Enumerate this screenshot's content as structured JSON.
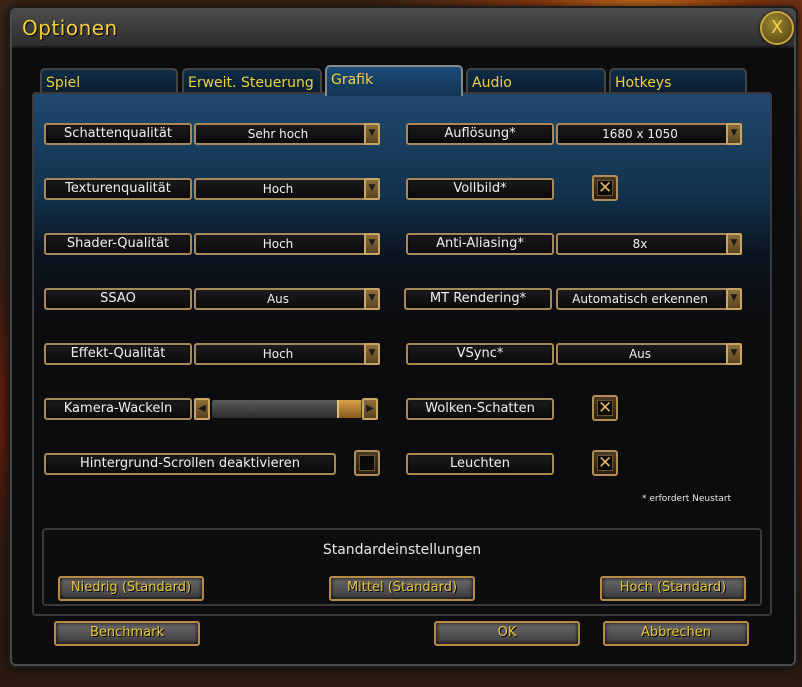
{
  "window": {
    "title": "Optionen",
    "close_glyph": "X"
  },
  "tabs": [
    {
      "label": "Spiel",
      "active": false
    },
    {
      "label": "Erweit. Steuerung",
      "active": false
    },
    {
      "label": "Grafik",
      "active": true
    },
    {
      "label": "Audio",
      "active": false
    },
    {
      "label": "Hotkeys",
      "active": false
    }
  ],
  "left_settings": [
    {
      "label": "Schattenqualität",
      "type": "dropdown",
      "value": "Sehr hoch"
    },
    {
      "label": "Texturenqualität",
      "type": "dropdown",
      "value": "Hoch"
    },
    {
      "label": "Shader-Qualität",
      "type": "dropdown",
      "value": "Hoch"
    },
    {
      "label": "SSAO",
      "type": "dropdown",
      "value": "Aus"
    },
    {
      "label": "Effekt-Qualität",
      "type": "dropdown",
      "value": "Hoch"
    },
    {
      "label": "Kamera-Wackeln",
      "type": "slider",
      "value_fraction": 0.92
    },
    {
      "label": "Hintergrund-Scrollen deaktivieren",
      "type": "checkbox",
      "checked": false
    }
  ],
  "right_settings": [
    {
      "label": "Auflösung*",
      "type": "dropdown",
      "value": "1680 x 1050"
    },
    {
      "label": "Vollbild*",
      "type": "checkbox",
      "checked": true
    },
    {
      "label": "Anti-Aliasing*",
      "type": "dropdown",
      "value": "8x"
    },
    {
      "label": "MT Rendering*",
      "type": "dropdown",
      "value": "Automatisch erkennen"
    },
    {
      "label": "VSync*",
      "type": "dropdown",
      "value": "Aus"
    },
    {
      "label": "Wolken-Schatten",
      "type": "checkbox",
      "checked": true
    },
    {
      "label": "Leuchten",
      "type": "checkbox",
      "checked": true
    }
  ],
  "note": "* erfordert Neustart",
  "defaults": {
    "title": "Standardeinstellungen",
    "low": "Niedrig (Standard)",
    "medium": "Mittel (Standard)",
    "high": "Hoch (Standard)"
  },
  "footer": {
    "benchmark": "Benchmark",
    "ok": "OK",
    "cancel": "Abbrechen"
  },
  "glyphs": {
    "dropdown_arrow": "▼",
    "slider_left": "◀",
    "slider_right": "▶",
    "check_mark": "✕"
  },
  "colors": {
    "accent_gold": "#f0d040",
    "border_bronze": "#a88858",
    "tab_blue": "#133653"
  }
}
